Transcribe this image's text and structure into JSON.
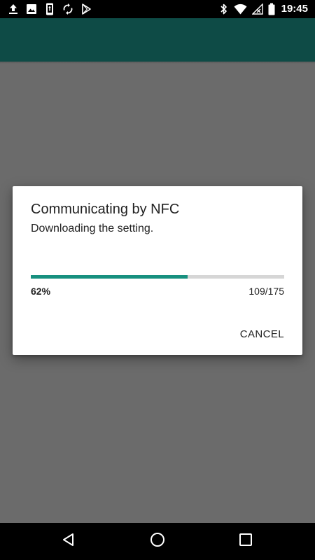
{
  "status_bar": {
    "time": "19:45",
    "left_icons": [
      "upload-icon",
      "image-icon",
      "phone-data-icon",
      "sync-icon",
      "play-store-icon"
    ],
    "right_icons": [
      "bluetooth-icon",
      "wifi-icon",
      "no-signal-icon",
      "battery-icon"
    ]
  },
  "colors": {
    "app_bar": "#0e4b46",
    "scrim": "#6b6b6b",
    "progress_accent": "#17907f",
    "progress_track": "#d6d6d6"
  },
  "dialog": {
    "title": "Communicating by NFC",
    "message": "Downloading the setting.",
    "progress": {
      "fraction": 0.62,
      "percent_label": "62%",
      "count_label": "109/175"
    },
    "cancel_label": "CANCEL"
  },
  "nav_bar": {
    "buttons": [
      "back-icon",
      "home-icon",
      "recents-icon"
    ]
  }
}
